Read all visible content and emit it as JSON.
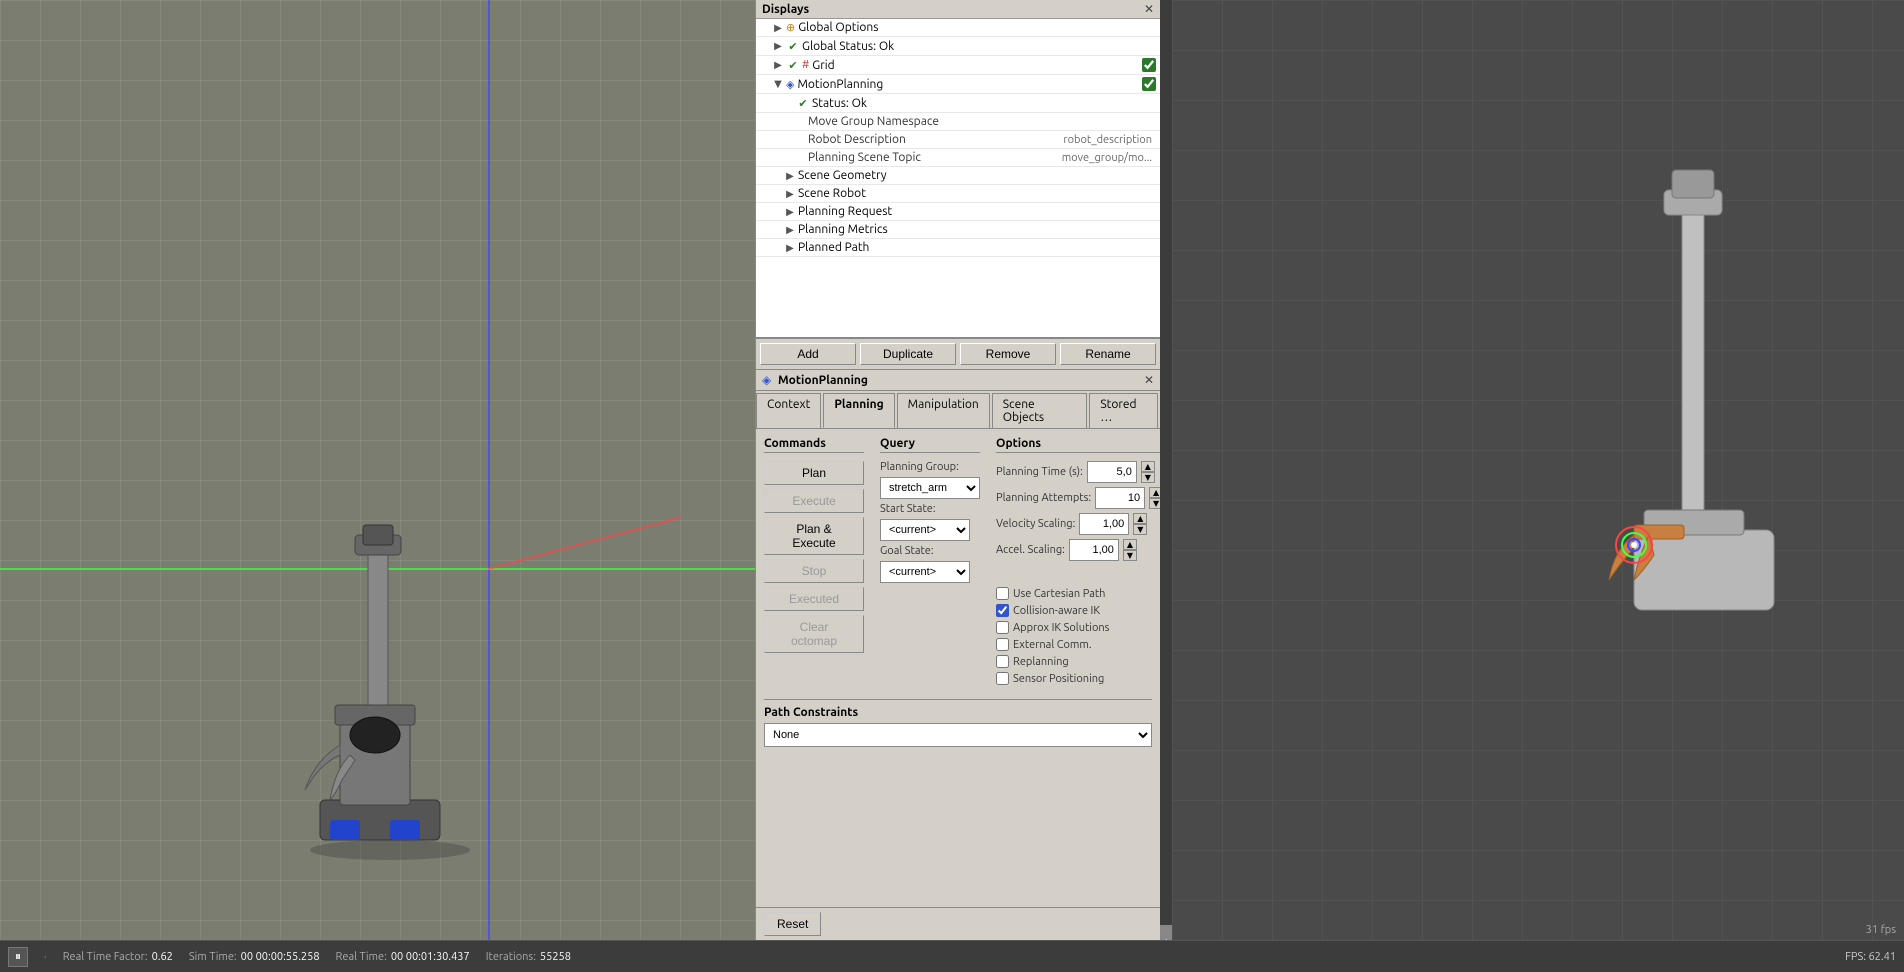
{
  "displays": {
    "title": "Displays",
    "items": [
      {
        "id": "global-options",
        "label": "Global Options",
        "indent": 1,
        "arrow": "▶",
        "icon": "globe",
        "checked": null
      },
      {
        "id": "global-status",
        "label": "Global Status: Ok",
        "indent": 1,
        "arrow": "▶",
        "icon": "check",
        "checked": null
      },
      {
        "id": "grid",
        "label": "Grid",
        "indent": 1,
        "arrow": "▶",
        "icon": "grid",
        "checked": true
      },
      {
        "id": "motion-planning",
        "label": "MotionPlanning",
        "indent": 1,
        "arrow": "▼",
        "icon": "motion",
        "checked": true
      },
      {
        "id": "status-ok",
        "label": "Status: Ok",
        "indent": 3,
        "arrow": "",
        "icon": "check",
        "checked": null
      },
      {
        "id": "move-group-ns",
        "label": "Move Group Namespace",
        "indent": 3,
        "arrow": "",
        "icon": "",
        "value": ""
      },
      {
        "id": "robot-description",
        "label": "Robot Description",
        "indent": 3,
        "arrow": "",
        "icon": "",
        "value": "robot_description"
      },
      {
        "id": "planning-scene-topic",
        "label": "Planning Scene Topic",
        "indent": 3,
        "arrow": "",
        "icon": "",
        "value": "move_group/mo..."
      },
      {
        "id": "scene-geometry",
        "label": "Scene Geometry",
        "indent": 2,
        "arrow": "▶",
        "icon": "",
        "checked": null
      },
      {
        "id": "scene-robot",
        "label": "Scene Robot",
        "indent": 2,
        "arrow": "▶",
        "icon": "",
        "checked": null
      },
      {
        "id": "planning-request",
        "label": "Planning Request",
        "indent": 2,
        "arrow": "▶",
        "icon": "",
        "checked": null
      },
      {
        "id": "planning-metrics",
        "label": "Planning Metrics",
        "indent": 2,
        "arrow": "▶",
        "icon": "",
        "checked": null
      },
      {
        "id": "planned-path",
        "label": "Planned Path",
        "indent": 2,
        "arrow": "▶",
        "icon": "",
        "checked": null
      }
    ]
  },
  "panel_buttons": {
    "add": "Add",
    "duplicate": "Duplicate",
    "remove": "Remove",
    "rename": "Rename"
  },
  "motion_planning": {
    "title": "MotionPlanning",
    "tabs": [
      "Context",
      "Planning",
      "Manipulation",
      "Scene Objects",
      "Stored States"
    ],
    "active_tab": "Planning",
    "commands": {
      "title": "Commands",
      "plan": "Plan",
      "execute": "Execute",
      "plan_execute": "Plan & Execute",
      "stop": "Stop",
      "executed": "Executed",
      "clear_octomap": "Clear octomap"
    },
    "query": {
      "title": "Query",
      "planning_group_label": "Planning Group:",
      "planning_group_value": "stretch_arm",
      "start_state_label": "Start State:",
      "start_state_value": "<current>",
      "goal_state_label": "Goal State:",
      "goal_state_value": "<current>"
    },
    "options": {
      "title": "Options",
      "planning_time_label": "Planning Time (s):",
      "planning_time_value": "5,0",
      "planning_attempts_label": "Planning Attempts:",
      "planning_attempts_value": "10",
      "velocity_scaling_label": "Velocity Scaling:",
      "velocity_scaling_value": "1,00",
      "accel_scaling_label": "Accel. Scaling:",
      "accel_scaling_value": "1,00",
      "use_cartesian_path": "Use Cartesian Path",
      "use_cartesian_path_checked": false,
      "collision_aware_ik": "Collision-aware IK",
      "collision_aware_ik_checked": true,
      "approx_ik_solutions": "Approx IK Solutions",
      "approx_ik_solutions_checked": false,
      "external_comm": "External Comm.",
      "external_comm_checked": false,
      "replanning": "Replanning",
      "replanning_checked": false,
      "sensor_positioning": "Sensor Positioning",
      "sensor_positioning_checked": false
    },
    "path_constraints": {
      "title": "Path Constraints",
      "value": "None"
    },
    "reset_button": "Reset"
  },
  "status_bar": {
    "pause_label": "⏸",
    "real_time_factor_label": "Real Time Factor:",
    "real_time_factor_value": "0.62",
    "sim_time_label": "Sim Time:",
    "sim_time_value": "00 00:00:55.258",
    "real_time_label": "Real Time:",
    "real_time_value": "00 00:01:30.437",
    "iterations_label": "Iterations:",
    "iterations_value": "55258",
    "fps_left": "FPS: 62.41",
    "fps_right": "31 fps"
  }
}
